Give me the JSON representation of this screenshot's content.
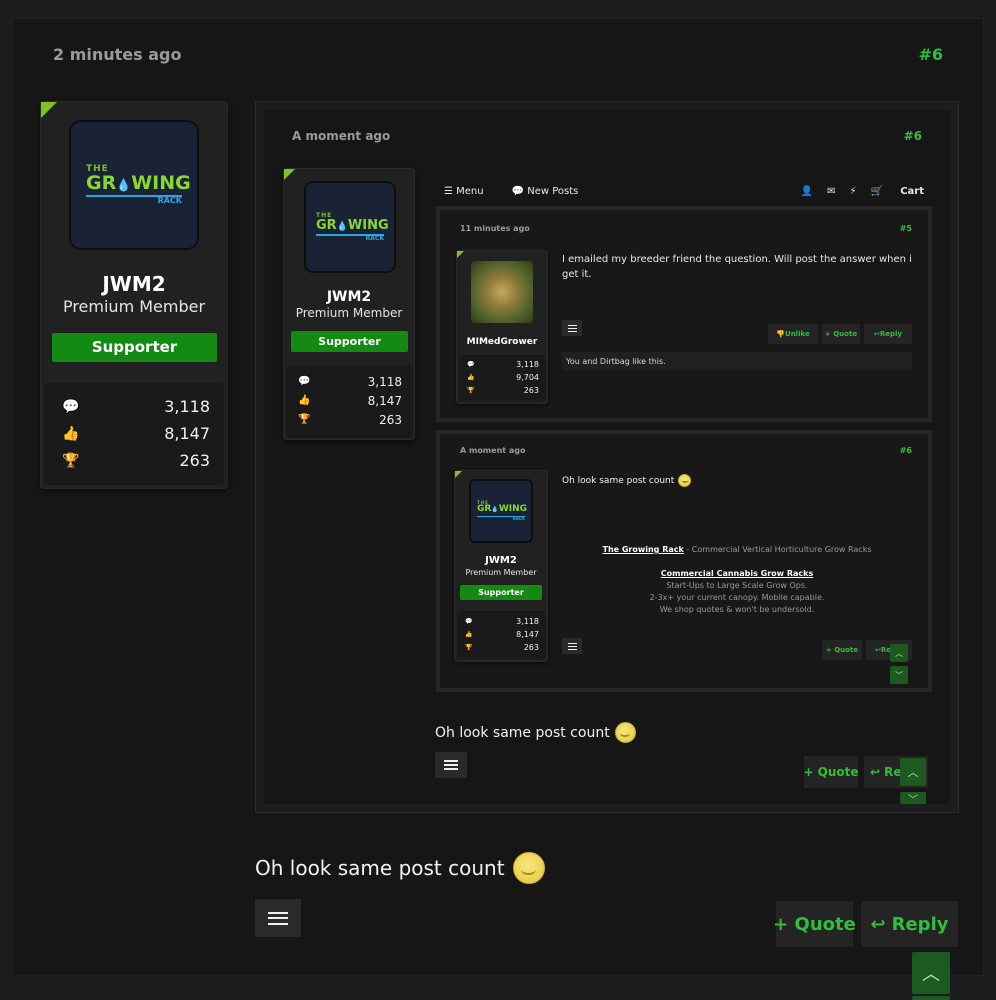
{
  "post": {
    "time": "2 minutes ago",
    "number": "#6",
    "user": {
      "name": "JWM2",
      "title": "Premium Member",
      "badge": "Supporter",
      "stats": [
        "3,118",
        "8,147",
        "263"
      ]
    },
    "text": "Oh look same post count",
    "actions": {
      "quote": "+ Quote",
      "reply": "Reply"
    }
  },
  "logo": {
    "the": "THE",
    "main_a": "GR",
    "drop": "💧",
    "main_b": "WING",
    "rack": "RACK"
  },
  "icons": {
    "messages": "comments-icon",
    "likes": "thumbs-up-icon",
    "trophies": "trophy-icon",
    "menu": "hamburger-menu-icon",
    "reply": "reply-arrow-icon",
    "scroll_up": "chevron-up-icon",
    "scroll_down": "chevron-down-icon"
  },
  "colors": {
    "accent_green": "#2fbf3a",
    "badge_green": "#138a12",
    "corner": "#7fc31c",
    "background": "#161616"
  },
  "screenshot1": {
    "time": "A moment ago",
    "number": "#6",
    "nav": {
      "menu": "Menu",
      "new_posts": "New Posts",
      "cart": "Cart"
    },
    "user": {
      "name": "JWM2",
      "title": "Premium Member",
      "badge": "Supporter",
      "stats": [
        "3,118",
        "8,147",
        "263"
      ]
    },
    "text": "Oh look same post count",
    "actions": {
      "quote": "+ Quote",
      "reply": "Reply"
    }
  },
  "screenshot2": {
    "post5": {
      "time": "11 minutes ago",
      "number": "#5",
      "user": {
        "name": "MIMedGrower",
        "stats": [
          "3,118",
          "9,704",
          "263"
        ]
      },
      "text": "I emailed my breeder friend the question. Will post the answer when i get it.",
      "actions": {
        "unlike": "Unlike",
        "quote": "+ Quote",
        "reply": "Reply"
      },
      "likes": "You and Dirtbag like this."
    },
    "post6": {
      "time": "A moment ago",
      "number": "#6",
      "user": {
        "name": "JWM2",
        "title": "Premium Member",
        "badge": "Supporter",
        "stats": [
          "3,118",
          "8,147",
          "263"
        ]
      },
      "text": "Oh look same post count",
      "signature": {
        "link1": "The Growing Rack",
        "tail1": " - Commercial Vertical Horticulture Grow Racks",
        "link2": "Commercial Cannabis Grow Racks",
        "line3": "Start-Ups to Large Scale Grow Ops.",
        "line4": "2-3x+ your current canopy. Mobile capable.",
        "line5": "We shop quotes & won't be undersold."
      },
      "actions": {
        "quote": "+ Quote",
        "reply": "Reply"
      }
    }
  }
}
